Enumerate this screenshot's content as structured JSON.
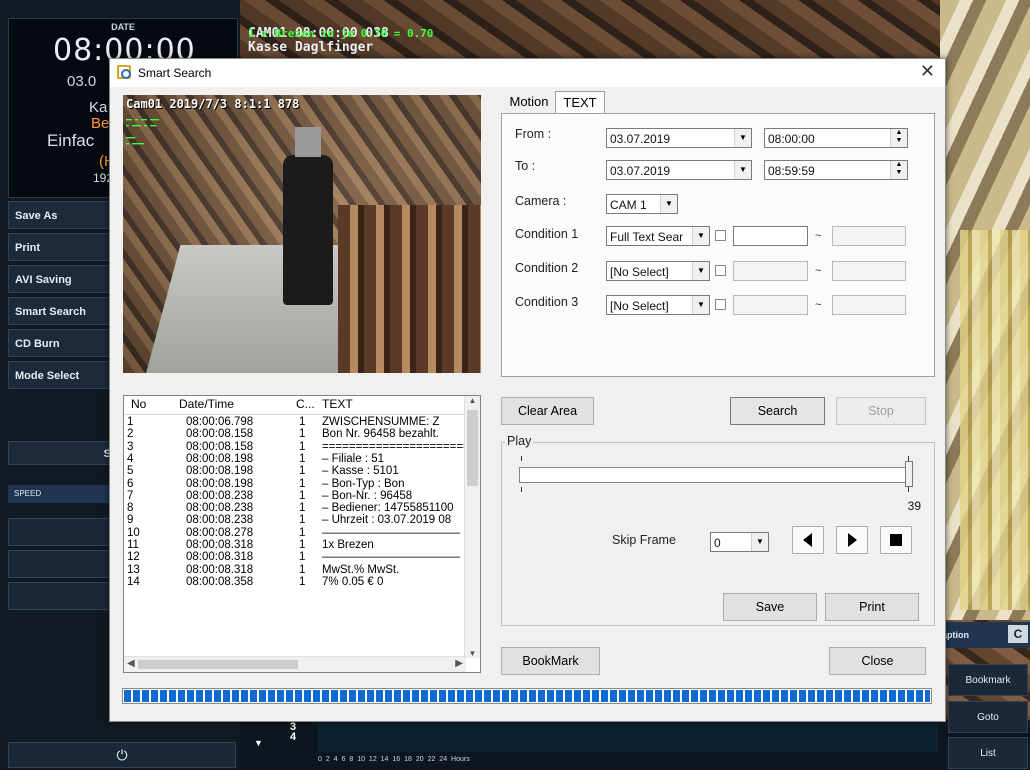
{
  "background": {
    "date_label": "DATE",
    "time": "08:00:00",
    "date": "03.0",
    "lines": [
      "Ka",
      "Bev",
      "Einfac",
      "(H",
      "192"
    ],
    "menu": [
      "Save As",
      "Print",
      "AVI Saving",
      "Smart Search",
      "CD Burn",
      "Mode Select",
      "Search"
    ],
    "speed_label": "SPEED",
    "controls": [
      "◀◀",
      "◀",
      "|◀"
    ],
    "power_icon": "⏻",
    "cam_overlay_title": "CAM01 08:00:00 038",
    "cam_overlay_green": "1 x  Brezen  zu je 0.70 = 0.70",
    "cam_overlay_sub": "Kasse Daglfinger",
    "right_buttons": [
      "Bookmark",
      "Goto",
      "List"
    ],
    "caption": "aption",
    "caption_btn": "C",
    "timeline_nums": [
      "3",
      "4"
    ],
    "timeline_ticks": "0  2  4  6  8  10  12  14  16  18  20  22  24 Hours"
  },
  "dialog": {
    "title": "Smart Search",
    "close": "✕",
    "preview_caption": "Cam01 2019/7/3 8:1:1 878",
    "tabs": {
      "motion": "Motion",
      "text": "TEXT"
    },
    "form": {
      "from_label": "From :",
      "from_date": "03.07.2019",
      "from_time": "08:00:00",
      "to_label": "To :",
      "to_date": "03.07.2019",
      "to_time": "08:59:59",
      "camera_label": "Camera :",
      "camera_value": "CAM 1",
      "cond1_label": "Condition 1",
      "cond1_value": "Full Text Sear",
      "cond2_label": "Condition 2",
      "cond2_value": "[No Select]",
      "cond3_label": "Condition 3",
      "cond3_value": "[No Select]",
      "tilde": "~"
    },
    "list": {
      "headers": {
        "no": "No",
        "datetime": "Date/Time",
        "c": "C...",
        "text": "TEXT"
      },
      "rows": [
        {
          "no": "1",
          "dt": "08:00:06.798",
          "c": "1",
          "text": "ZWISCHENSUMME: Z"
        },
        {
          "no": "2",
          "dt": "08:00:08.158",
          "c": "1",
          "text": "Bon Nr. 96458 bezahlt."
        },
        {
          "no": "3",
          "dt": "08:00:08.158",
          "c": "1",
          "text": "========================"
        },
        {
          "no": "4",
          "dt": "08:00:08.198",
          "c": "1",
          "text": "– Filiale : 51"
        },
        {
          "no": "5",
          "dt": "08:00:08.198",
          "c": "1",
          "text": "– Kasse   : 5101"
        },
        {
          "no": "6",
          "dt": "08:00:08.198",
          "c": "1",
          "text": "– Bon-Typ : Bon"
        },
        {
          "no": "7",
          "dt": "08:00:08.238",
          "c": "1",
          "text": "– Bon-Nr. : 96458"
        },
        {
          "no": "8",
          "dt": "08:00:08.238",
          "c": "1",
          "text": "– Bediener: 14755851100"
        },
        {
          "no": "9",
          "dt": "08:00:08.238",
          "c": "1",
          "text": "– Uhrzeit : 03.07.2019 08"
        },
        {
          "no": "10",
          "dt": "08:00:08.278",
          "c": "1",
          "text": "————————————"
        },
        {
          "no": "11",
          "dt": "08:00:08.318",
          "c": "1",
          "text": "1x Brezen"
        },
        {
          "no": "12",
          "dt": "08:00:08.318",
          "c": "1",
          "text": "————————————"
        },
        {
          "no": "13",
          "dt": "08:00:08.318",
          "c": "1",
          "text": "MwSt.%          MwSt."
        },
        {
          "no": "14",
          "dt": "08:00:08.358",
          "c": "1",
          "text": "7%              0.05 €    0"
        }
      ]
    },
    "buttons": {
      "clear_area": "Clear Area",
      "search": "Search",
      "stop": "Stop",
      "save": "Save",
      "print": "Print",
      "bookmark": "BookMark",
      "close": "Close"
    },
    "play": {
      "group_label": "Play",
      "slider_value": "39",
      "skip_label": "Skip Frame",
      "skip_value": "0"
    },
    "progress_percent": 100
  }
}
